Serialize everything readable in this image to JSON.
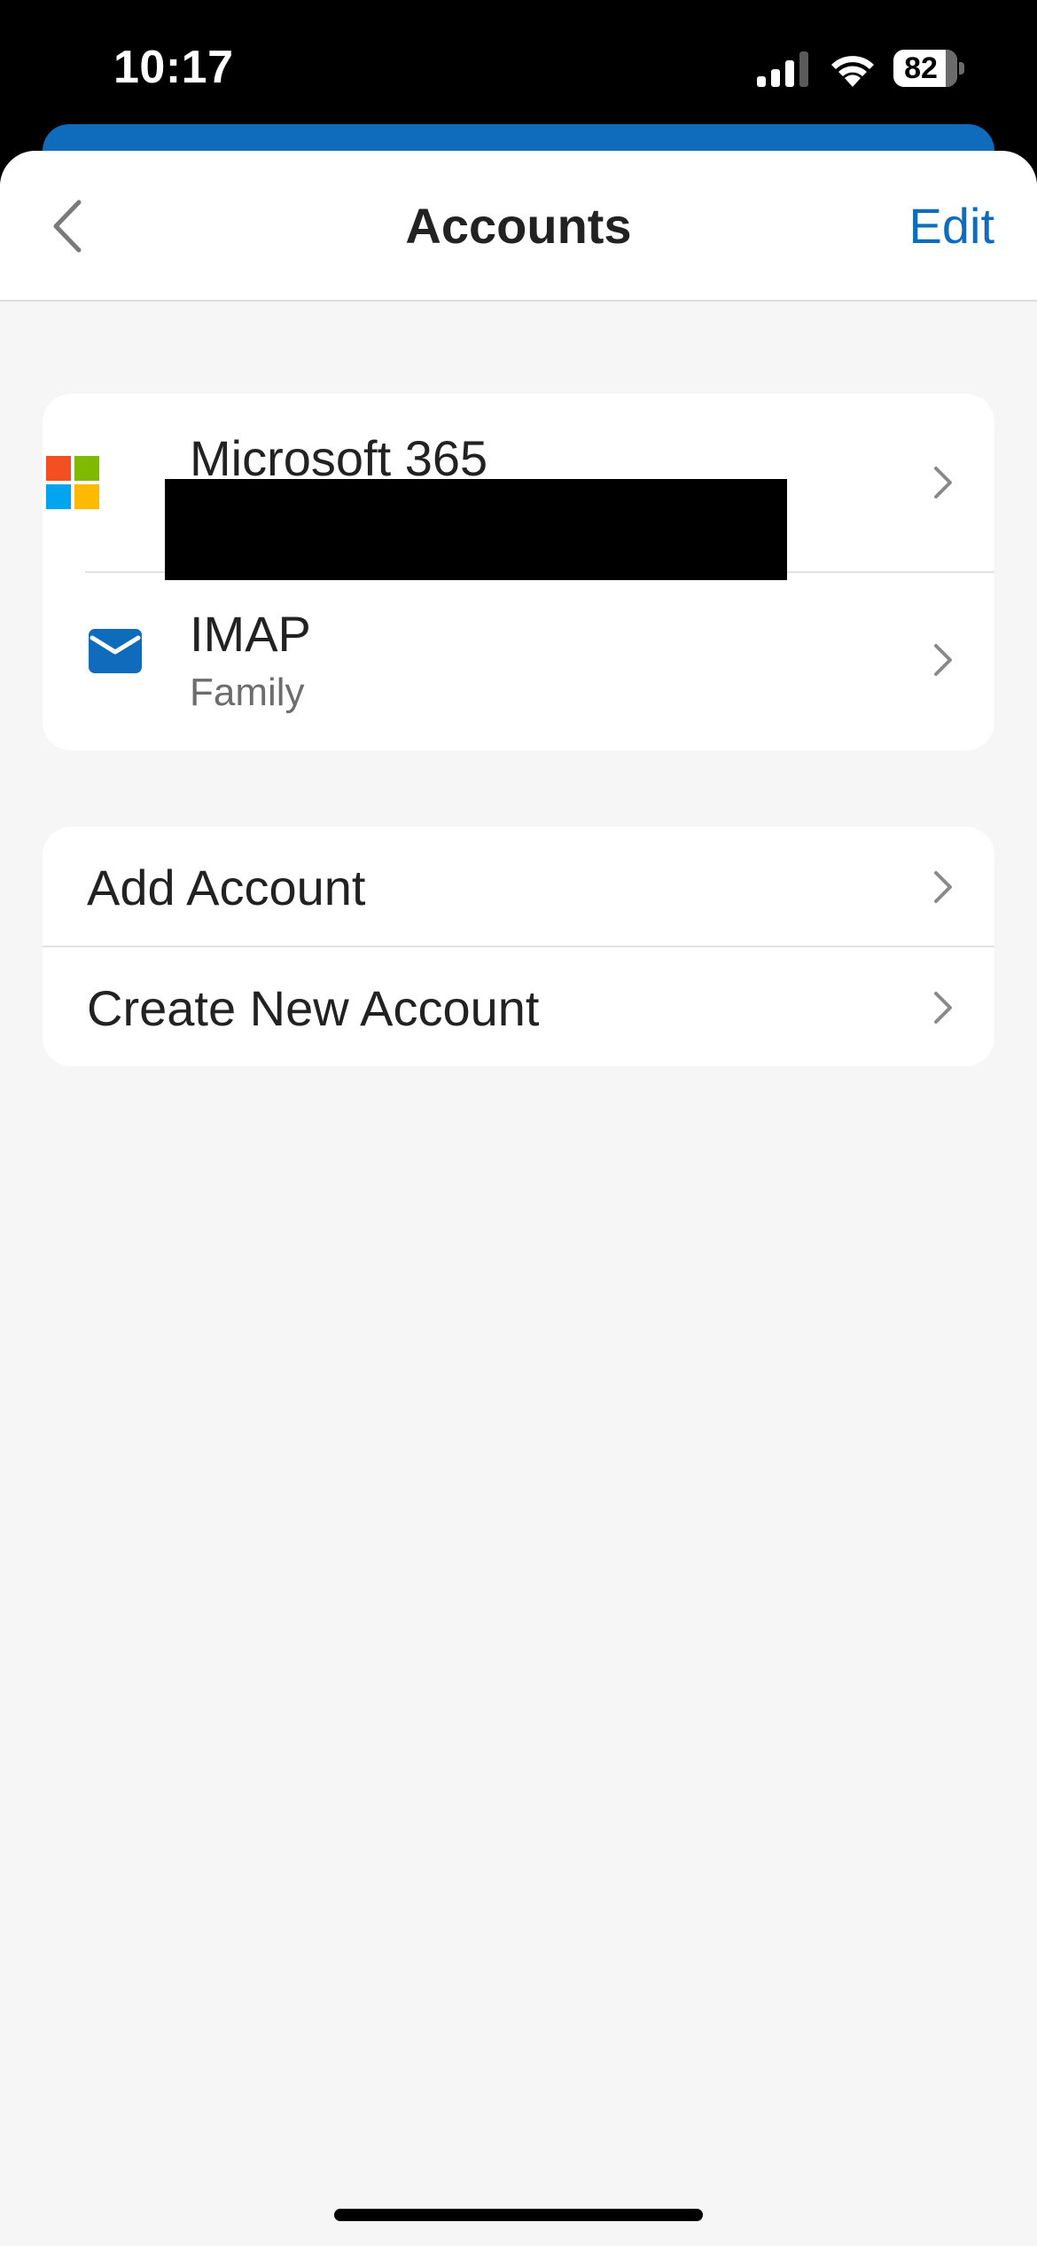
{
  "status_bar": {
    "time": "10:17",
    "battery_percent": "82",
    "battery_level": 0.82,
    "signal_icon": "cellular-signal-icon",
    "wifi_icon": "wifi-icon"
  },
  "nav": {
    "title": "Accounts",
    "edit_label": "Edit",
    "back_icon": "chevron-left-icon"
  },
  "accounts": [
    {
      "title": "Microsoft 365",
      "subtitle": "",
      "icon": "microsoft-logo-icon"
    },
    {
      "title": "IMAP",
      "subtitle": "Family",
      "icon": "mail-icon"
    }
  ],
  "actions": [
    {
      "label": "Add Account"
    },
    {
      "label": "Create New Account"
    }
  ],
  "colors": {
    "accent": "#0f6cbd",
    "background": "#f6f6f6",
    "ms_red": "#f25022",
    "ms_green": "#7fba00",
    "ms_blue": "#00a4ef",
    "ms_yellow": "#ffb900"
  }
}
